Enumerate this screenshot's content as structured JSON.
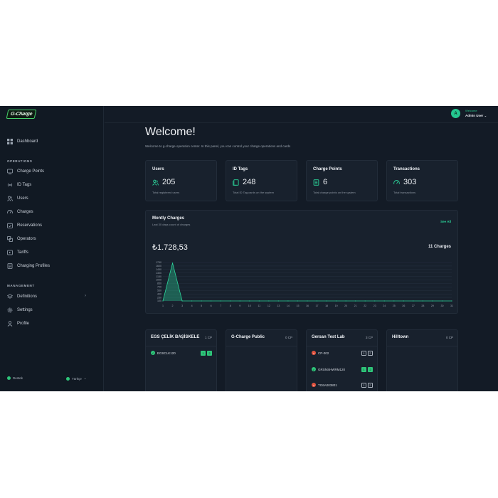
{
  "brand": {
    "logo_text": "G-Charge"
  },
  "sidebar": {
    "dashboard": "Dashboard",
    "operations_label": "OPERATIONS",
    "operations": [
      {
        "label": "Charge Points",
        "icon": "monitor-icon"
      },
      {
        "label": "ID Tags",
        "icon": "rfid-icon"
      },
      {
        "label": "Users",
        "icon": "users-icon"
      },
      {
        "label": "Charges",
        "icon": "gauge-icon"
      },
      {
        "label": "Reservations",
        "icon": "calendar-check-icon"
      },
      {
        "label": "Operators",
        "icon": "operators-icon"
      },
      {
        "label": "Tariffs",
        "icon": "tariff-icon"
      },
      {
        "label": "Charging Profiles",
        "icon": "profile-doc-icon"
      }
    ],
    "management_label": "MANAGEMENT",
    "management": [
      {
        "label": "Definitions",
        "icon": "layers-icon"
      },
      {
        "label": "Settings",
        "icon": "gear-icon"
      },
      {
        "label": "Profile",
        "icon": "person-icon"
      }
    ],
    "footer": {
      "support": "Destek",
      "language": "Türkçe",
      "language_chevron": "⌄"
    }
  },
  "header": {
    "avatar_letter": "A",
    "greeting": "Welcome",
    "user_name": "Admin User",
    "user_chevron": "⌄"
  },
  "welcome": {
    "title": "Welcome!",
    "subtitle": "Welcome to g-charge operation center. In this panel, you can control your charge operations and cards"
  },
  "stats": [
    {
      "title": "Users",
      "value": "205",
      "desc": "Total registered users",
      "icon": "users-icon"
    },
    {
      "title": "ID Tags",
      "value": "248",
      "desc": "Total ID Tag cards on the system",
      "icon": "id-tag-icon"
    },
    {
      "title": "Charge Points",
      "value": "6",
      "desc": "Total charge points on the system",
      "icon": "charger-icon"
    },
    {
      "title": "Transactions",
      "value": "303",
      "desc": "Total transactions",
      "icon": "gauge-icon"
    }
  ],
  "monthly": {
    "title": "Montly Charges",
    "subtitle": "Last 30 days count of charges",
    "see_all": "See All",
    "amount": "₺1.728,53",
    "count": "11 Charges"
  },
  "chart_data": {
    "type": "area",
    "x": [
      1,
      2,
      3,
      4,
      5,
      6,
      7,
      8,
      9,
      10,
      11,
      12,
      13,
      14,
      15,
      16,
      17,
      18,
      19,
      20,
      21,
      22,
      23,
      24,
      25,
      26,
      27,
      28,
      29,
      30,
      31
    ],
    "series": [
      {
        "values": [
          0,
          1728,
          0,
          0,
          0,
          0,
          0,
          0,
          0,
          0,
          0,
          0,
          0,
          0,
          0,
          0,
          0,
          0,
          0,
          0,
          0,
          0,
          0,
          0,
          0,
          0,
          0,
          0,
          0,
          0,
          0
        ]
      }
    ],
    "y_ticks": [
      100,
      250,
      400,
      550,
      700,
      850,
      1000,
      1150,
      1300,
      1450,
      1600,
      1750
    ],
    "ylim": [
      100,
      1750
    ],
    "grid": true,
    "color": "#2bd49a"
  },
  "charge_points": [
    {
      "name": "EGS ÇELİK BAŞİSKELE",
      "count": "1 CP",
      "items": [
        {
          "id": "EGSCLK120",
          "status": "ok",
          "connectors": [
            {
              "label": "1",
              "style": "g"
            },
            {
              "label": "2",
              "style": "g"
            }
          ]
        }
      ]
    },
    {
      "name": "G-Charge Public",
      "count": "0 CP",
      "items": []
    },
    {
      "name": "Gersan Test Lab",
      "count": "3 CP",
      "items": [
        {
          "id": "CP-002",
          "status": "err",
          "connectors": [
            {
              "label": "1",
              "style": "o"
            },
            {
              "label": "2",
              "style": "o"
            }
          ]
        },
        {
          "id": "GRSNSHWRM120",
          "status": "ok",
          "connectors": [
            {
              "label": "1",
              "style": "g"
            },
            {
              "label": "2",
              "style": "g"
            }
          ]
        },
        {
          "id": "TG6A003801",
          "status": "err",
          "connectors": [
            {
              "label": "1",
              "style": "o"
            },
            {
              "label": "2",
              "style": "o"
            }
          ]
        }
      ]
    },
    {
      "name": "Hilltown",
      "count": "0 CP",
      "items": []
    }
  ]
}
